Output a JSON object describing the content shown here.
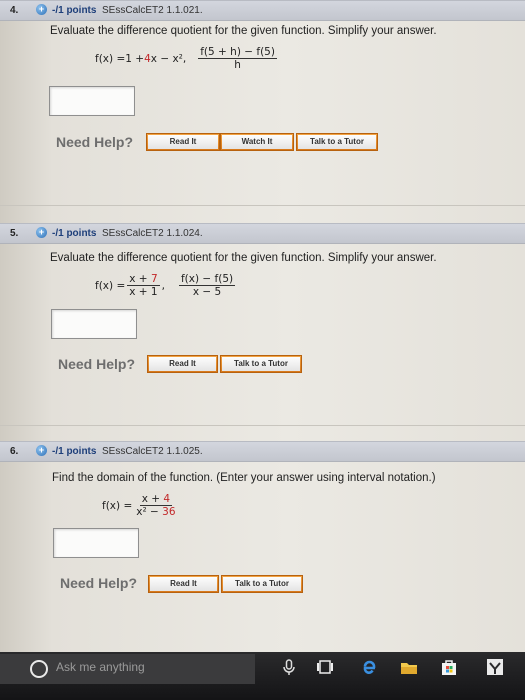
{
  "questions": [
    {
      "number": "4.",
      "points": "-/1 points",
      "code": "SEssCalcET2 1.1.021.",
      "prompt": "Evaluate the difference quotient for the given function. Simplify your answer.",
      "function_lhs": "f(x) = ",
      "function_rhs_pre": "1 + ",
      "function_rhs_red": "4",
      "function_rhs_post": "x − x²,",
      "quotient_num": "f(5 + h) − f(5)",
      "quotient_den": "h",
      "need_help": "Need Help?",
      "buttons": [
        "Read It",
        "Watch It",
        "Talk to a Tutor"
      ]
    },
    {
      "number": "5.",
      "points": "-/1 points",
      "code": "SEssCalcET2 1.1.024.",
      "prompt": "Evaluate the difference quotient for the given function. Simplify your answer.",
      "function_lhs": "f(x) = ",
      "frac_num_pre": "x + ",
      "frac_num_red": "7",
      "frac_den": "x + 1",
      "comma": ",",
      "quotient_num": "f(x) − f(5)",
      "quotient_den": "x − 5",
      "need_help": "Need Help?",
      "buttons": [
        "Read It",
        "Talk to a Tutor"
      ]
    },
    {
      "number": "6.",
      "points": "-/1 points",
      "code": "SEssCalcET2 1.1.025.",
      "prompt": "Find the domain of the function. (Enter your answer using interval notation.)",
      "function_lhs": "f(x) = ",
      "frac_num_pre": "x + ",
      "frac_num_red": "4",
      "frac_den_pre": "x² − ",
      "frac_den_red": "36",
      "need_help": "Need Help?",
      "buttons": [
        "Read It",
        "Talk to a Tutor"
      ]
    }
  ],
  "taskbar": {
    "search_placeholder": "Ask me anything",
    "icons": [
      "cortana-icon",
      "microphone-icon",
      "task-view-icon",
      "edge-icon",
      "file-explorer-icon",
      "store-icon",
      "app-icon"
    ]
  },
  "colors": {
    "link_blue": "#1e3f7a",
    "highlight_red": "#c2282a",
    "button_orange": "#e48a2a",
    "taskbar": "#1a1a1c"
  }
}
